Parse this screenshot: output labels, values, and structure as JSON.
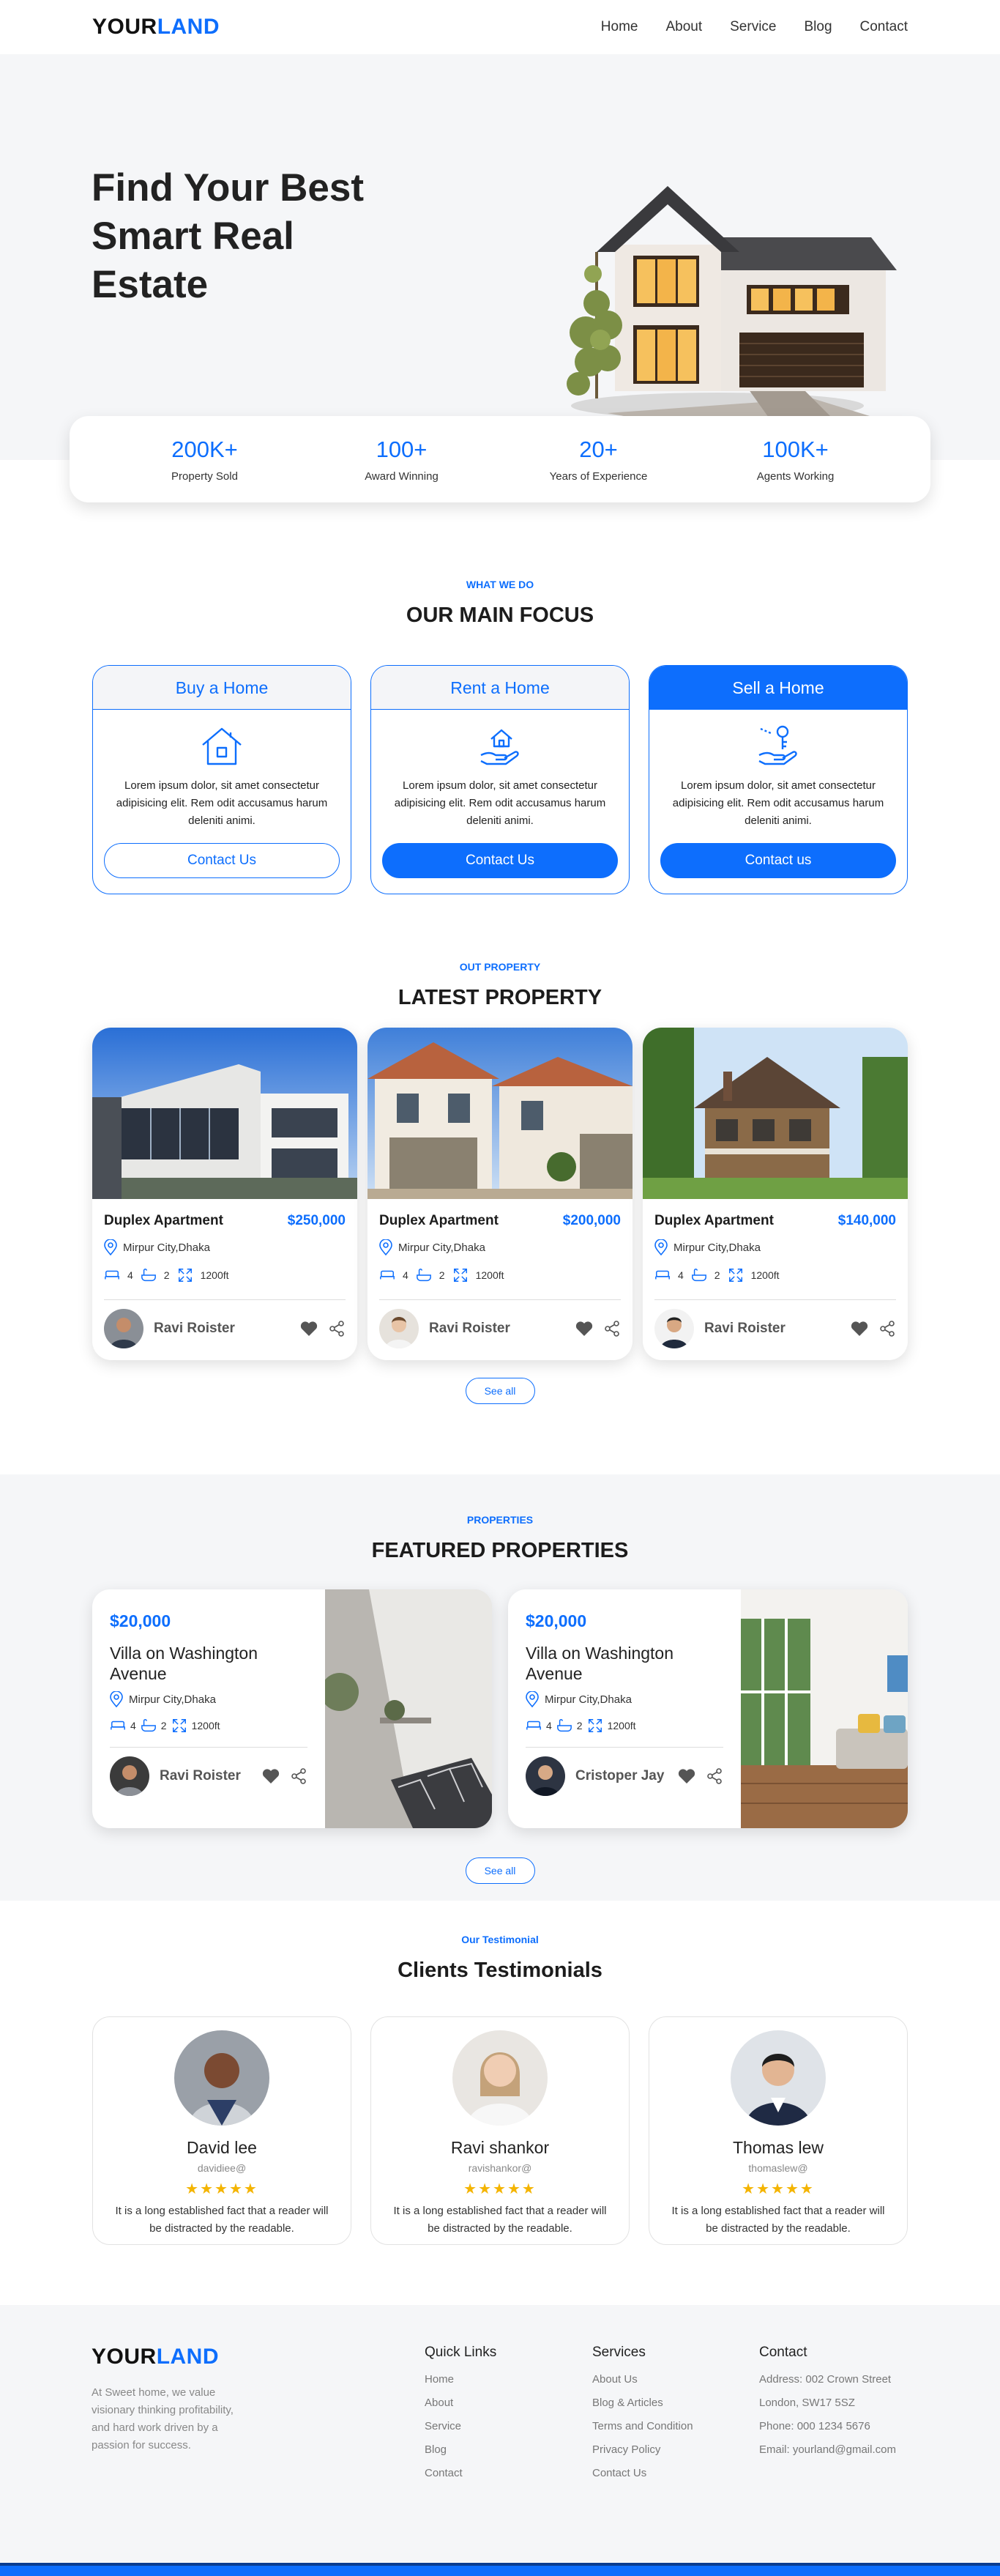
{
  "brand": {
    "part1": "YOUR",
    "part2": "LAND"
  },
  "nav": [
    "Home",
    "About",
    "Service",
    "Blog",
    "Contact"
  ],
  "hero": {
    "title": "Find Your Best Smart Real Estate"
  },
  "stats": [
    {
      "value": "200K+",
      "label": "Property Sold"
    },
    {
      "value": "100+",
      "label": "Award Winning"
    },
    {
      "value": "20+",
      "label": "Years of Experience"
    },
    {
      "value": "100K+",
      "label": "Agents Working"
    }
  ],
  "focus": {
    "sub": "WHAT WE DO",
    "title": "OUR MAIN FOCUS",
    "cards": [
      {
        "title": "Buy a Home",
        "icon": "house-icon",
        "text": "Lorem ipsum dolor, sit amet consectetur adipisicing elit. Rem odit accusamus harum deleniti animi.",
        "button": "Contact Us"
      },
      {
        "title": "Rent a Home",
        "icon": "hand-house-icon",
        "text": "Lorem ipsum dolor, sit amet consectetur adipisicing elit. Rem odit accusamus harum deleniti animi.",
        "button": "Contact Us"
      },
      {
        "title": "Sell a Home",
        "icon": "hand-key-icon",
        "text": "Lorem ipsum dolor, sit amet consectetur adipisicing elit. Rem odit accusamus harum deleniti animi.",
        "button": "Contact us"
      }
    ]
  },
  "latest": {
    "sub": "OUT PROPERTY",
    "title": "LATEST PROPERTY",
    "cards": [
      {
        "name": "Duplex Apartment",
        "price": "$250,000",
        "location": "Mirpur City,Dhaka",
        "beds": "4",
        "baths": "2",
        "area": "1200ft",
        "agent": "Ravi Roister"
      },
      {
        "name": "Duplex Apartment",
        "price": "$200,000",
        "location": "Mirpur City,Dhaka",
        "beds": "4",
        "baths": "2",
        "area": "1200ft",
        "agent": "Ravi Roister"
      },
      {
        "name": "Duplex Apartment",
        "price": "$140,000",
        "location": "Mirpur City,Dhaka",
        "beds": "4",
        "baths": "2",
        "area": "1200ft",
        "agent": "Ravi Roister"
      }
    ],
    "see_all": "See all"
  },
  "featured": {
    "sub": "PROPERTIES",
    "title": "FEATURED PROPERTIES",
    "cards": [
      {
        "price": "$20,000",
        "name": "Villa on Washington Avenue",
        "location": "Mirpur City,Dhaka",
        "beds": "4",
        "baths": "2",
        "area": "1200ft",
        "agent": "Ravi Roister"
      },
      {
        "price": "$20,000",
        "name": "Villa on Washington Avenue",
        "location": "Mirpur City,Dhaka",
        "beds": "4",
        "baths": "2",
        "area": "1200ft",
        "agent": "Cristoper Jay"
      }
    ],
    "see_all": "See all"
  },
  "testimonials": {
    "sub": "Our Testimonial",
    "title": "Clients Testimonials",
    "cards": [
      {
        "name": "David lee",
        "handle": "davidiee@",
        "stars": "★★★★★",
        "quote": "It is a long established fact that a reader will be distracted by the readable."
      },
      {
        "name": "Ravi shankor",
        "handle": "ravishankor@",
        "stars": "★★★★★",
        "quote": "It is a long established fact that a reader will be distracted by the readable."
      },
      {
        "name": "Thomas lew",
        "handle": "thomaslew@",
        "stars": "★★★★★",
        "quote": "It is a long established fact that a reader will be distracted by the readable."
      }
    ]
  },
  "footer": {
    "description": "At Sweet home, we value visionary thinking profitability, and hard work driven by a passion for success.",
    "quick_links": {
      "title": "Quick Links",
      "items": [
        "Home",
        "About",
        "Service",
        "Blog",
        "Contact"
      ]
    },
    "services": {
      "title": "Services",
      "items": [
        "About Us",
        "Blog & Articles",
        "Terms and Condition",
        "Privacy Policy",
        "Contact Us"
      ]
    },
    "contact": {
      "title": "Contact",
      "items": [
        "Address: 002 Crown Street",
        "London, SW17 5SZ",
        "Phone: 000 1234 5676",
        "Email: yourland@gmail.com"
      ]
    }
  },
  "colors": {
    "accent": "#0d6efd",
    "bg_light": "#f5f6f8"
  }
}
